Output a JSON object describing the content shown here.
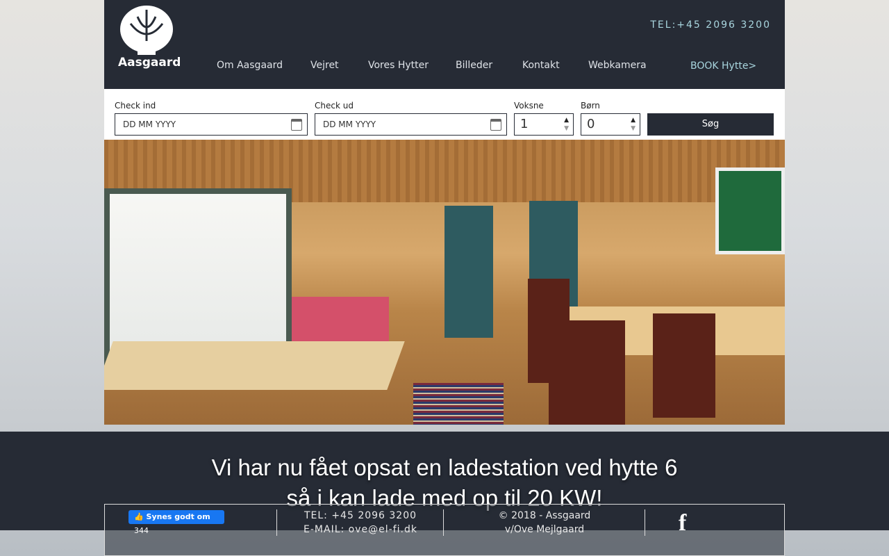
{
  "header": {
    "logo_text": "Aasgaard",
    "tel": "TEL:+45 2096 3200",
    "nav": [
      "Om Aasgaard",
      "Vejret",
      "Vores Hytter",
      "Billeder",
      "Kontakt",
      "Webkamera"
    ],
    "book": "BOOK Hytte>"
  },
  "booking": {
    "checkin_label": "Check ind",
    "checkin_placeholder": "DD MM YYYY",
    "checkout_label": "Check ud",
    "checkout_placeholder": "DD MM YYYY",
    "adults_label": "Voksne",
    "adults_value": "1",
    "children_label": "Børn",
    "children_value": "0",
    "search": "Søg"
  },
  "banner": {
    "line1": "Vi har nu fået opsat en ladestation ved hytte 6",
    "line2": "så i kan lade med op til 20 KW!"
  },
  "footer": {
    "like_label": "Synes godt om",
    "like_count": "344",
    "tel": "TEL: +45 2096 3200",
    "email": "E-MAIL: ove@el-fi.dk",
    "copyright": "© 2018 - Assgaard",
    "owner": "v/Ove Mejlgaard",
    "facebook_glyph": "f"
  }
}
